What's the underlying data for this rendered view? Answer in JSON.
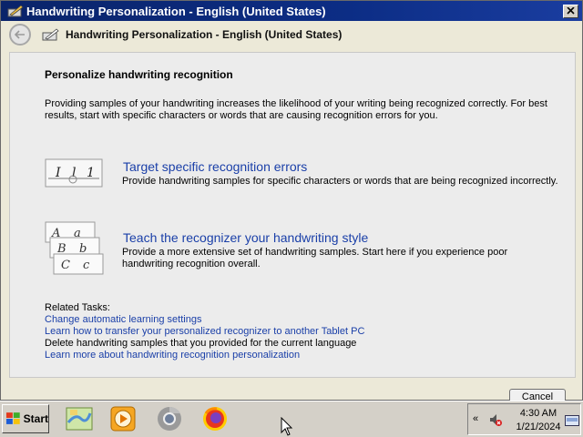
{
  "window": {
    "title": "Handwriting Personalization - English (United States)",
    "nav_title": "Handwriting Personalization - English (United States)"
  },
  "main": {
    "heading": "Personalize handwriting recognition",
    "intro": "Providing samples of your handwriting increases the likelihood of your writing being recognized correctly. For best results, start with specific characters or words that are causing recognition errors for you.",
    "options": [
      {
        "title": "Target specific recognition errors",
        "description": "Provide handwriting samples for specific characters or words that are being recognized incorrectly.",
        "image_chars": [
          "I",
          "l",
          "1"
        ]
      },
      {
        "title": "Teach the recognizer your handwriting style",
        "description": "Provide a more extensive set of handwriting samples. Start here if you experience poor handwriting recognition overall.",
        "image_chars": [
          "A",
          "a",
          "B",
          "b",
          "C",
          "c"
        ]
      }
    ],
    "related": {
      "label": "Related Tasks:",
      "items": [
        "Change automatic learning settings",
        "Learn how to transfer your personalized recognizer to another Tablet PC",
        "Delete handwriting samples that you provided for the current language",
        "Learn more about handwriting recognition personalization"
      ]
    },
    "cancel_label": "Cancel"
  },
  "taskbar": {
    "start_label": "Start",
    "time": "4:30 AM",
    "date": "1/21/2024",
    "tray_chevron": "«"
  },
  "colors": {
    "titlebar": "#0a246a",
    "link": "#1a3fa8",
    "content_bg": "#ececec"
  }
}
